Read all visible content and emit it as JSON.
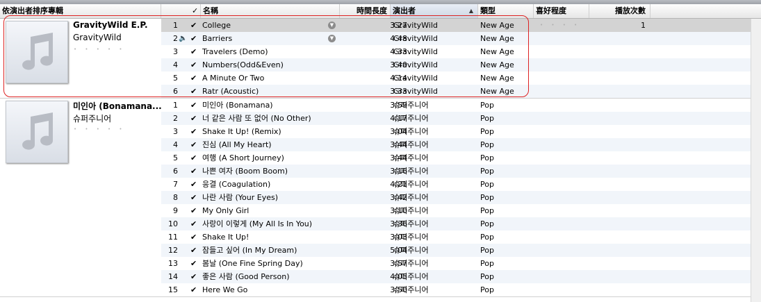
{
  "header": {
    "album_by_artist": "依演出者排序專輯",
    "check": "✓",
    "name": "名稱",
    "time": "時間長度",
    "artist": "演出者",
    "genre": "類型",
    "rating": "喜好程度",
    "plays": "播放次數"
  },
  "albums": [
    {
      "title": "GravityWild E.P.",
      "artist": "GravityWild",
      "stars": "• • • • •",
      "tracks": [
        {
          "num": "1",
          "name": "College",
          "time": "3:27",
          "artist": "GravityWild",
          "genre": "New Age",
          "rating": "• • • • •",
          "plays": "1"
        },
        {
          "num": "2",
          "name": "Barriers",
          "time": "4:48",
          "artist": "GravityWild",
          "genre": "New Age",
          "rating": "",
          "plays": ""
        },
        {
          "num": "3",
          "name": "Travelers (Demo)",
          "time": "4:33",
          "artist": "GravityWild",
          "genre": "New Age",
          "rating": "",
          "plays": ""
        },
        {
          "num": "4",
          "name": "Numbers(Odd&Even)",
          "time": "3:40",
          "artist": "GravityWild",
          "genre": "New Age",
          "rating": "",
          "plays": ""
        },
        {
          "num": "5",
          "name": "A Minute Or Two",
          "time": "4:14",
          "artist": "GravityWild",
          "genre": "New Age",
          "rating": "",
          "plays": ""
        },
        {
          "num": "6",
          "name": "Ratr (Acoustic)",
          "time": "3:33",
          "artist": "GravityWild",
          "genre": "New Age",
          "rating": "",
          "plays": ""
        }
      ]
    },
    {
      "title": "미인아 (Bonamana...",
      "artist": "슈퍼주니어",
      "stars": "• • • • •",
      "tracks": [
        {
          "num": "1",
          "name": "미인아 (Bonamana)",
          "time": "3:59",
          "artist": "슈퍼주니어",
          "genre": "Pop"
        },
        {
          "num": "2",
          "name": "너 같은 사람 또 없어 (No Other)",
          "time": "4:17",
          "artist": "슈퍼주니어",
          "genre": "Pop"
        },
        {
          "num": "3",
          "name": "Shake It Up! (Remix)",
          "time": "3:04",
          "artist": "슈퍼주니어",
          "genre": "Pop"
        },
        {
          "num": "4",
          "name": "진심 (All My Heart)",
          "time": "3:44",
          "artist": "슈퍼주니어",
          "genre": "Pop"
        },
        {
          "num": "5",
          "name": "여행 (A Short Journey)",
          "time": "3:44",
          "artist": "슈퍼주니어",
          "genre": "Pop"
        },
        {
          "num": "6",
          "name": "나쁜 여자 (Boom Boom)",
          "time": "3:16",
          "artist": "슈퍼주니어",
          "genre": "Pop"
        },
        {
          "num": "7",
          "name": "응결 (Coagulation)",
          "time": "4:21",
          "artist": "슈퍼주니어",
          "genre": "Pop"
        },
        {
          "num": "8",
          "name": "나란 사람 (Your Eyes)",
          "time": "3:42",
          "artist": "슈퍼주니어",
          "genre": "Pop"
        },
        {
          "num": "9",
          "name": "My Only Girl",
          "time": "3:10",
          "artist": "슈퍼주니어",
          "genre": "Pop"
        },
        {
          "num": "10",
          "name": "사랑이 이렇게 (My All Is In You)",
          "time": "3:36",
          "artist": "슈퍼주니어",
          "genre": "Pop"
        },
        {
          "num": "11",
          "name": "Shake It Up!",
          "time": "3:03",
          "artist": "슈퍼주니어",
          "genre": "Pop"
        },
        {
          "num": "12",
          "name": "잠들고 싶어 (In My Dream)",
          "time": "5:04",
          "artist": "슈퍼주니어",
          "genre": "Pop"
        },
        {
          "num": "13",
          "name": "봄날 (One Fine Spring Day)",
          "time": "3:57",
          "artist": "슈퍼주니어",
          "genre": "Pop"
        },
        {
          "num": "14",
          "name": "좋은 사람 (Good Person)",
          "time": "4:05",
          "artist": "슈퍼주니어",
          "genre": "Pop"
        },
        {
          "num": "15",
          "name": "Here We Go",
          "time": "3:50",
          "artist": "슈퍼주니어",
          "genre": "Pop"
        }
      ]
    }
  ],
  "playing_track": "Barriers",
  "selected_track": "College",
  "colors": {
    "selection": "#d3d3d3",
    "alt_row": "#f1f5fa",
    "highlight": "#dd2222",
    "speaker": "#3b78c8"
  },
  "icons": [
    "music-note-icon",
    "speaker-icon",
    "checkmark-icon",
    "arrow-circle-icon",
    "sort-up-icon"
  ]
}
